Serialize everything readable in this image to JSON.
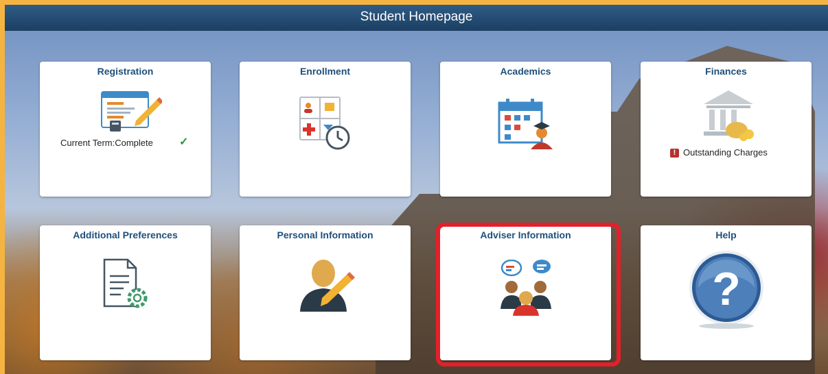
{
  "header": {
    "title": "Student Homepage"
  },
  "tiles": [
    {
      "title": "Registration",
      "icon": "registration-icon",
      "status": "Current Term:Complete",
      "status_icon": "checkmark-icon"
    },
    {
      "title": "Enrollment",
      "icon": "enrollment-icon"
    },
    {
      "title": "Academics",
      "icon": "academics-calendar-icon"
    },
    {
      "title": "Finances",
      "icon": "finances-bank-icon",
      "status": "Outstanding Charges",
      "status_icon": "alert-icon",
      "alert_glyph": "!"
    },
    {
      "title": "Additional Preferences",
      "icon": "document-settings-icon"
    },
    {
      "title": "Personal Information",
      "icon": "person-edit-icon"
    },
    {
      "title": "Adviser Information",
      "icon": "adviser-group-icon",
      "highlighted": true
    },
    {
      "title": "Help",
      "icon": "help-question-icon",
      "glyph": "?"
    }
  ],
  "colors": {
    "header": "#1b3f63",
    "tile_title": "#1e4f7a",
    "highlight": "#e3202a",
    "alert": "#b8312f",
    "check": "#1f9a3a",
    "border": "#f5b441"
  }
}
